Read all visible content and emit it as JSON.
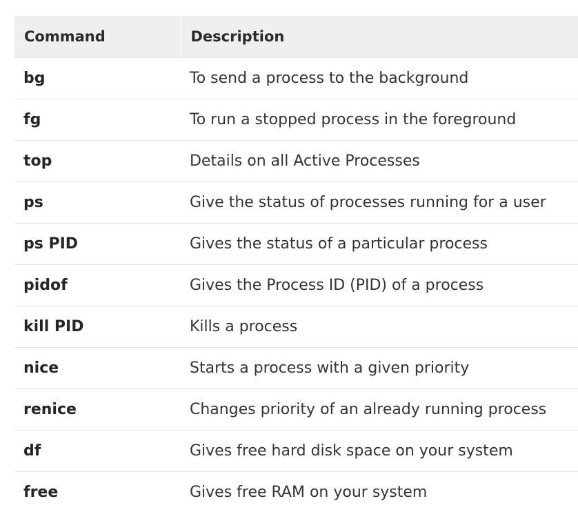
{
  "table": {
    "headers": {
      "command": "Command",
      "description": "Description"
    },
    "rows": [
      {
        "command": "bg",
        "description": "To send a process to the background"
      },
      {
        "command": "fg",
        "description": "To run a stopped process in the foreground"
      },
      {
        "command": "top",
        "description": "Details on all Active Processes"
      },
      {
        "command": "ps",
        "description": "Give the status of processes running for a user"
      },
      {
        "command": "ps PID",
        "description": "Gives the status of a particular process"
      },
      {
        "command": "pidof",
        "description": "Gives the Process ID (PID) of a process"
      },
      {
        "command": "kill PID",
        "description": "Kills a process"
      },
      {
        "command": "nice",
        "description": "Starts a process with a given priority"
      },
      {
        "command": "renice",
        "description": "Changes priority of an already running process"
      },
      {
        "command": "df",
        "description": "Gives free hard disk space on your system"
      },
      {
        "command": "free",
        "description": "Gives free RAM on your system"
      }
    ]
  }
}
